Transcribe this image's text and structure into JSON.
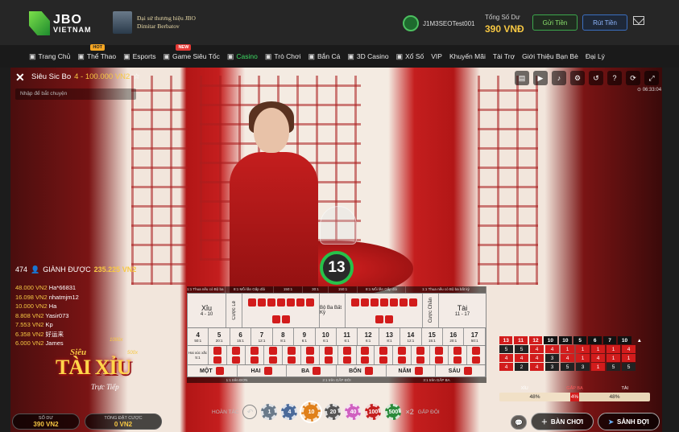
{
  "brand": {
    "name": "JBO",
    "sub": "VIETNAM"
  },
  "ambassador": {
    "line1": "Đại sứ thương hiệu JBO",
    "line2": "Dimitar Berbatov"
  },
  "user": {
    "name": "J1M3SEOTest001"
  },
  "balance": {
    "label": "Tổng Số Dư",
    "value": "390 VNĐ"
  },
  "actions": {
    "deposit": "Gửi Tiền",
    "withdraw": "Rút Tiền"
  },
  "nav": [
    {
      "label": "Trang Chủ",
      "icon": "home-icon"
    },
    {
      "label": "Thể Thao",
      "icon": "soccer-ball-icon",
      "badge": "HOT"
    },
    {
      "label": "Esports",
      "icon": "gamepad-icon"
    },
    {
      "label": "Game Siêu Tốc",
      "icon": "rocket-icon",
      "badge": "NEW"
    },
    {
      "label": "Casino",
      "icon": "casino-icon",
      "active": true
    },
    {
      "label": "Trò Chơi",
      "icon": "slot-icon"
    },
    {
      "label": "Bắn Cá",
      "icon": "fish-icon"
    },
    {
      "label": "3D Casino",
      "icon": "cube-icon"
    },
    {
      "label": "Xổ Số",
      "icon": "lottery-icon"
    },
    {
      "label": "VIP"
    },
    {
      "label": "Khuyến Mãi"
    },
    {
      "label": "Tài Trợ"
    },
    {
      "label": "Giới Thiệu Bạn Bè"
    },
    {
      "label": "Đại Lý"
    }
  ],
  "game": {
    "title": "Siêu Sic Bo",
    "range": "4 - 100.000 VN2",
    "chat_placeholder": "Nhập để bắt chuyện",
    "time": "⊙ 06:33:04",
    "result": "13"
  },
  "winners": {
    "count": "474",
    "label": "GIÀNH ĐƯỢC",
    "total": "235.225 VN2",
    "list": [
      {
        "amount": "48.000 VN2",
        "name": "Ha*66831"
      },
      {
        "amount": "16.098 VN2",
        "name": "nhatmjm12"
      },
      {
        "amount": "10.000 VN2",
        "name": "Ha"
      },
      {
        "amount": "8.808 VN2",
        "name": "Yasir073"
      },
      {
        "amount": "7.553 VN2",
        "name": "Kp"
      },
      {
        "amount": "6.358 VN2",
        "name": "好运来"
      },
      {
        "amount": "6.000 VN2",
        "name": "James"
      }
    ]
  },
  "promo": {
    "top": "Siêu",
    "main": "TÀI XỈU",
    "sub": "Trực Tiếp",
    "m1": "1000x",
    "m2": "500x"
  },
  "board": {
    "odds_top": [
      "1:1 Thua nếu có Bộ ba bất kỳ",
      "8:1 Mỗi lần Gấp đôi",
      "150:1",
      "30:1",
      "150:1",
      "8:1 Mỗi lần Gấp đôi",
      "1:1 Thua nếu có Bộ ba bất kỳ"
    ],
    "xiu": {
      "label": "Xỉu",
      "range": "4 - 10"
    },
    "tai": {
      "label": "Tài",
      "range": "11 - 17"
    },
    "le": "Cược Lẻ",
    "chan": "Cược Chẵn",
    "any_triple": "Bộ Ba Bất Kỳ",
    "sums": [
      {
        "n": "4",
        "o": "50:1"
      },
      {
        "n": "5",
        "o": "20:1"
      },
      {
        "n": "6",
        "o": "15:1"
      },
      {
        "n": "7",
        "o": "12:1"
      },
      {
        "n": "8",
        "o": "8:1"
      },
      {
        "n": "9",
        "o": "6:1"
      },
      {
        "n": "10",
        "o": "6:1"
      },
      {
        "n": "11",
        "o": "6:1"
      },
      {
        "n": "12",
        "o": "6:1"
      },
      {
        "n": "13",
        "o": "8:1"
      },
      {
        "n": "14",
        "o": "12:1"
      },
      {
        "n": "15",
        "o": "15:1"
      },
      {
        "n": "16",
        "o": "20:1"
      },
      {
        "n": "17",
        "o": "50:1"
      }
    ],
    "pair_lead": "Hai xúc xắc 5:1",
    "singles": [
      "MỘT",
      "HAI",
      "BA",
      "BỐN",
      "NĂM",
      "SÁU"
    ],
    "odds_bottom": [
      "1:1 trên ĐƠN",
      "2:1 trên GẤP ĐÔI",
      "3:1 trên GẤP BA"
    ]
  },
  "chips": {
    "undo_label": "HOÀN TÁC",
    "double_label": "GẤP ĐÔI",
    "values": [
      {
        "v": "1",
        "c": "#6a7a8a"
      },
      {
        "v": "4",
        "c": "#4a6a9a"
      },
      {
        "v": "10",
        "c": "#e0801a",
        "selected": true
      },
      {
        "v": "20",
        "c": "#555"
      },
      {
        "v": "40",
        "c": "#d060c0"
      },
      {
        "v": "100",
        "c": "#c41e1e"
      },
      {
        "v": "500",
        "c": "#2a8a3a"
      }
    ],
    "double": "×2"
  },
  "history": {
    "heads": [
      "13",
      "11",
      "12",
      "10",
      "10",
      "5",
      "6",
      "7",
      "10"
    ],
    "rows": [
      [
        "5",
        "5",
        "4",
        "4",
        "1",
        "1",
        "1",
        "1",
        "4"
      ],
      [
        "4",
        "4",
        "4",
        "3",
        "4",
        "1",
        "4",
        "1",
        "1"
      ],
      [
        "4",
        "2",
        "4",
        "3",
        "5",
        "3",
        "1",
        "5",
        "5"
      ]
    ]
  },
  "stats": {
    "labels": [
      "XỈU",
      "GẤP BA",
      "TÀI"
    ],
    "xiu": "48%",
    "triple": "4%",
    "tai": "48%",
    "xiu_pct": 48,
    "triple_pct": 4,
    "tai_pct": 48
  },
  "footer": {
    "balance_label": "SỐ DƯ",
    "balance_value": "390 VN2",
    "bet_label": "TỔNG ĐẶT CƯỢC",
    "bet_value": "0 VN2",
    "table_btn": "BÀN CHƠI",
    "lobby_btn": "SẢNH ĐỢI"
  },
  "colors": {
    "accent": "#3ddc64",
    "gold": "#f7c843",
    "red": "#d21c1c"
  }
}
